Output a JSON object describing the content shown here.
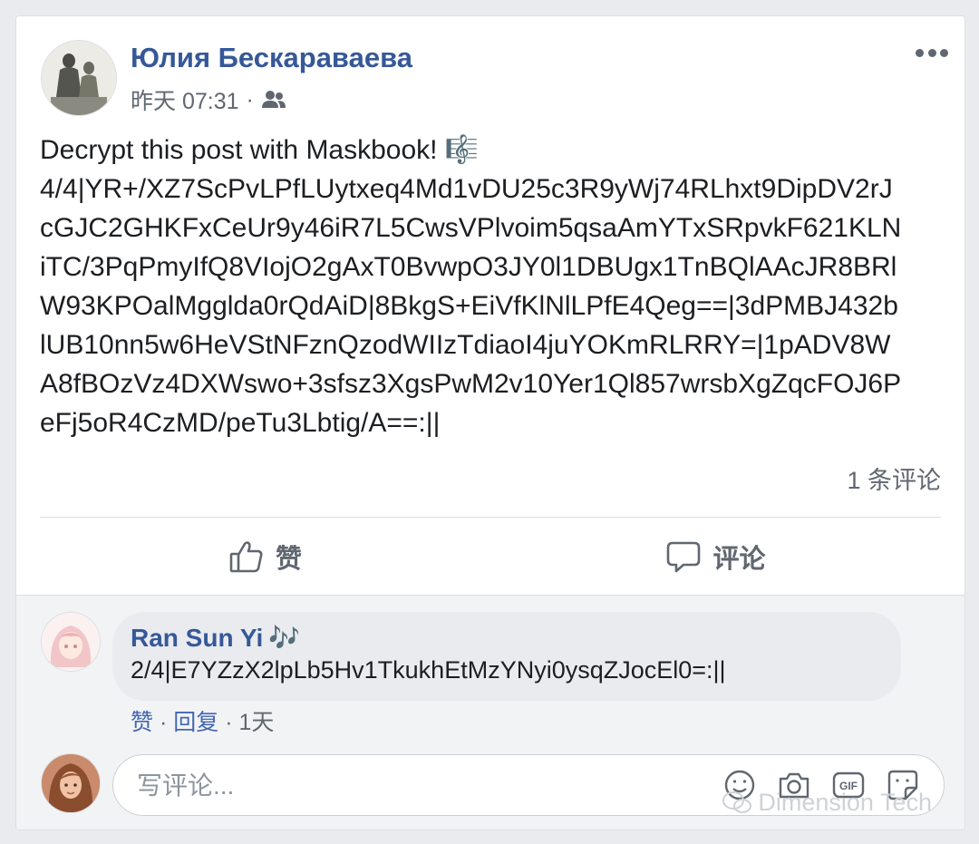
{
  "post": {
    "author": "Юлия Бескараваева",
    "time": "昨天 07:31",
    "time_separator": "·",
    "audience_icon": "friends-icon",
    "body_lines": [
      "Decrypt this post with Maskbook! 🎼",
      "4/4|YR+/XZ7ScPvLPfLUytxeq4Md1vDU25c3R9yWj74RLhxt9DipDV2rJ",
      "cGJC2GHKFxCeUr9y46iR7L5CwsVPlvoim5qsaAmYTxSRpvkF621KLN",
      "iTC/3PqPmyIfQ8VIojO2gAxT0BvwpO3JY0l1DBUgx1TnBQlAAcJR8BRl",
      "W93KPOalMgglda0rQdAiD|8BkgS+EiVfKlNlLPfE4Qeg==|3dPMBJ432b",
      "lUB10nn5w6HeVStNFznQzodWIIzTdiaoI4juYOKmRLRRY=|1pADV8W",
      "A8fBOzVz4DXWswo+3sfsz3XgsPwM2v10Yer1Ql857wrsbXgZqcFOJ6P",
      "eFj5oR4CzMD/peTu3Lbtig/A==:||"
    ],
    "comment_count": "1 条评论"
  },
  "actions": {
    "like_label": "赞",
    "comment_label": "评论"
  },
  "comment": {
    "author": "Ran Sun Yi",
    "author_suffix": "🎶",
    "text": "2/4|E7YZzX2lpLb5Hv1TkukhEtMzYNyi0ysqZJocEl0=:||",
    "like": "赞",
    "reply": "回复",
    "separator": " · ",
    "age": "1天"
  },
  "composer": {
    "placeholder": "写评论..."
  },
  "watermark": {
    "text": "Dimension Tech"
  },
  "colors": {
    "link": "#365899",
    "secondary_text": "#606770",
    "background": "#e9ebee"
  }
}
